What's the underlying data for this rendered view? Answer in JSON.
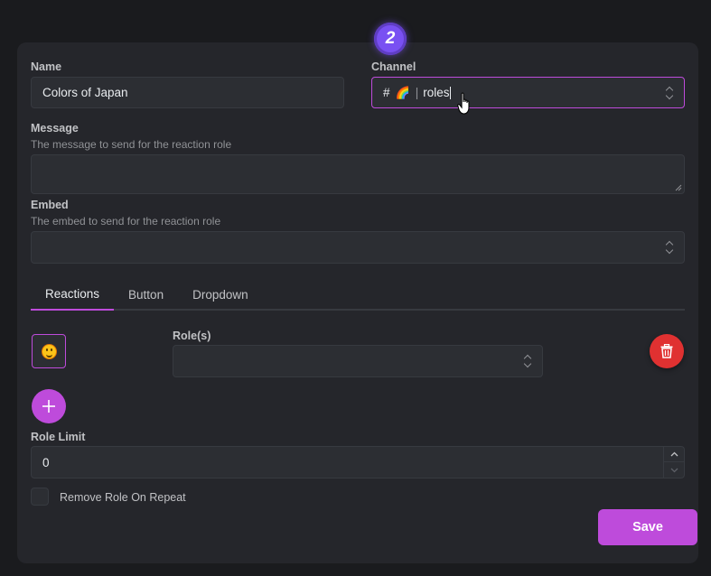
{
  "step": {
    "number": "2"
  },
  "name": {
    "label": "Name",
    "value": "Colors of Japan"
  },
  "channel": {
    "label": "Channel",
    "prefix": "#",
    "emoji": "🌈",
    "separator": "|",
    "value": "roles"
  },
  "message": {
    "label": "Message",
    "description": "The message to send for the reaction role",
    "value": ""
  },
  "embed": {
    "label": "Embed",
    "description": "The embed to send for the reaction role",
    "value": ""
  },
  "tabs": [
    {
      "label": "Reactions",
      "active": true
    },
    {
      "label": "Button",
      "active": false
    },
    {
      "label": "Dropdown",
      "active": false
    }
  ],
  "reaction": {
    "emoji_icon": "smiley-icon",
    "roles_label": "Role(s)",
    "roles_value": ""
  },
  "role_limit": {
    "label": "Role Limit",
    "value": "0"
  },
  "remove_role": {
    "label": "Remove Role On Repeat",
    "checked": false
  },
  "save": {
    "label": "Save"
  },
  "colors": {
    "accent": "#be4bdb",
    "danger": "#e03131",
    "badge": "#7950f2"
  }
}
